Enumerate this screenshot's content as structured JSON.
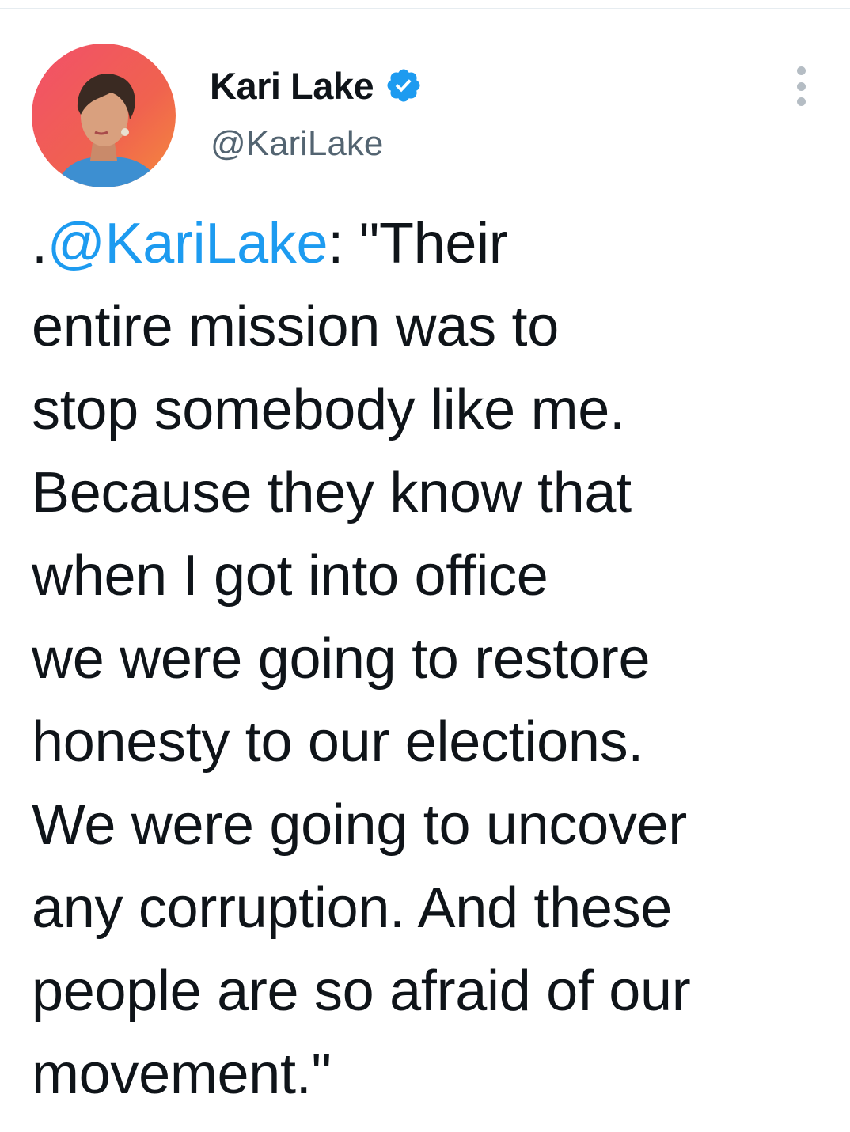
{
  "colors": {
    "link": "#1d9bf0",
    "text": "#0f1419",
    "secondary": "#536471",
    "verified": "#1d9bf0"
  },
  "author": {
    "display_name": "Kari Lake",
    "handle": "@KariLake",
    "verified": true,
    "avatar_icon": "profile-photo-avatar",
    "verified_icon": "verified-badge-icon"
  },
  "menu": {
    "icon": "more-options-icon"
  },
  "tweet": {
    "prefix": ".",
    "mention": "@KariLake",
    "lines": [
      ": \"Their",
      "entire mission was to",
      "stop somebody like me.",
      "Because they know that",
      "when I got into office",
      "we were going to restore",
      "honesty to our elections.",
      "We were going to uncover",
      "any corruption. And these",
      "people are so afraid of our",
      "movement.\""
    ]
  }
}
